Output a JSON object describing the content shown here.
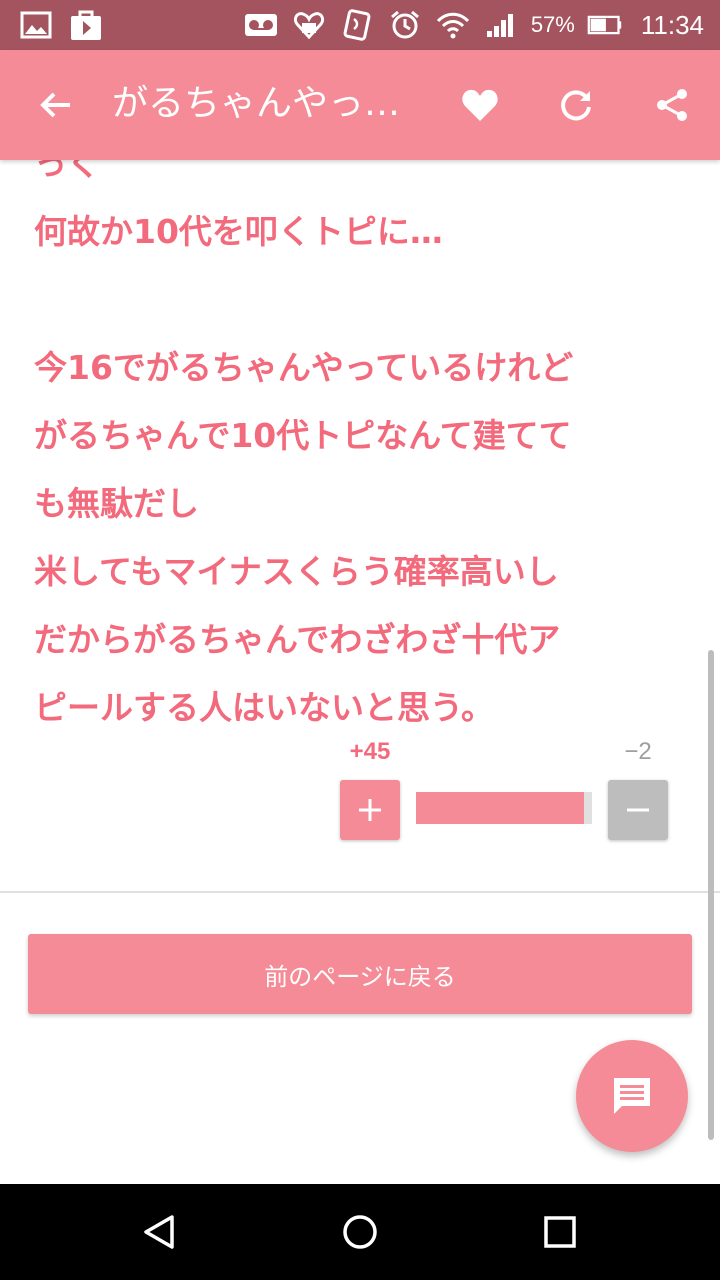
{
  "status_bar": {
    "left_icons": [
      "image-icon",
      "play-store-icon"
    ],
    "right_icons": [
      "voicemail-icon",
      "heart-badge-icon",
      "nfc-icon",
      "alarm-icon",
      "wifi-icon",
      "signal-icon"
    ],
    "battery": "57%",
    "time": "11:34"
  },
  "app_bar": {
    "title": "がるちゃんやっ…",
    "back_icon": "arrow-back-icon",
    "actions": [
      "heart-icon",
      "refresh-icon",
      "share-icon"
    ],
    "color": "#f58b96"
  },
  "comment": {
    "lines": [
      "っく",
      "何故か10代を叩くトピに…",
      "",
      "今16でがるちゃんやっているけれど",
      "がるちゃんで10代トピなんて建てて",
      "も無駄だし",
      "米してもマイナスくらう確率高いし",
      "だからがるちゃんでわざわざ十代ア",
      "ピールする人はいないと思う。"
    ],
    "color": "#f26a7c"
  },
  "votes": {
    "plus_count": "+45",
    "minus_count": "−2",
    "plus_symbol": "+",
    "minus_symbol": "−",
    "plus_ratio": 0.957
  },
  "back_button": {
    "label": "前のページに戻る"
  },
  "fab": {
    "icon": "comment-icon"
  },
  "nav_bar": {
    "buttons": [
      "back-triangle-icon",
      "home-circle-icon",
      "recents-square-icon"
    ]
  }
}
